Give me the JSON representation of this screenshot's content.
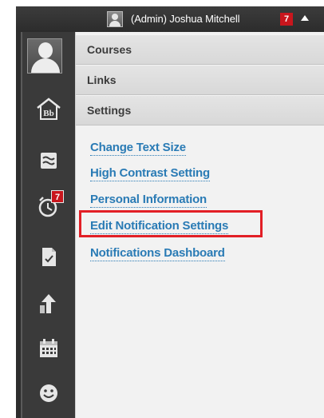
{
  "topbar": {
    "username": "(Admin) Joshua Mitchell",
    "notification_count": "7"
  },
  "rail": {
    "items": [
      {
        "icon": "avatar-icon"
      },
      {
        "icon": "bb-home-icon"
      },
      {
        "icon": "stream-icon"
      },
      {
        "icon": "alarm-clock-icon",
        "badge": "7"
      },
      {
        "icon": "document-check-icon"
      },
      {
        "icon": "grades-arrow-icon"
      },
      {
        "icon": "calendar-icon"
      },
      {
        "icon": "smiley-icon"
      }
    ]
  },
  "menu": {
    "courses": "Courses",
    "links": "Links",
    "settings": "Settings"
  },
  "settings_links": {
    "change_text_size": "Change Text Size",
    "high_contrast": "High Contrast Setting",
    "personal_information": "Personal Information",
    "edit_notification_settings": "Edit Notification Settings",
    "notifications_dashboard": "Notifications Dashboard"
  },
  "colors": {
    "link": "#2a7bb5",
    "highlight": "#e21f26",
    "badge": "#c9161d",
    "rail": "#3a3a3a"
  }
}
